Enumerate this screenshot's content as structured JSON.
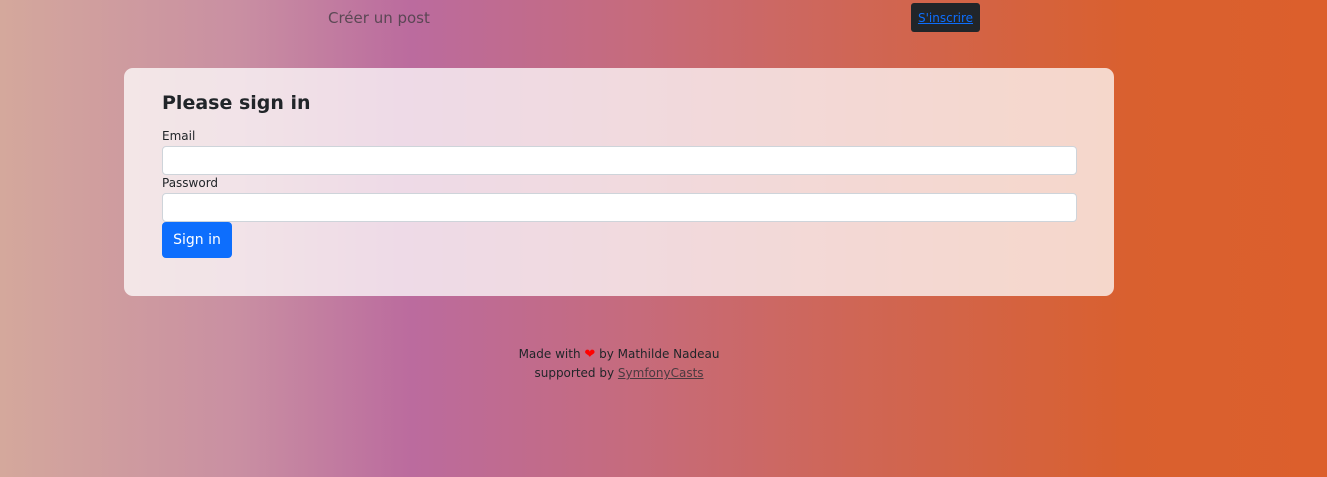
{
  "nav": {
    "create_post_label": "Créer un post",
    "signup_label": "S'inscrire"
  },
  "login": {
    "title": "Please sign in",
    "email_label": "Email",
    "email_value": "",
    "password_label": "Password",
    "password_value": "",
    "submit_label": "Sign in"
  },
  "footer": {
    "made_with": "Made with",
    "heart_icon": "heart-icon",
    "by_author": "by Mathilde Nadeau",
    "supported_by": "supported by",
    "sponsor_link": "SymfonyCasts"
  },
  "colors": {
    "primary": "#0d6efd",
    "dark": "#212529",
    "heart": "#ff0000"
  }
}
